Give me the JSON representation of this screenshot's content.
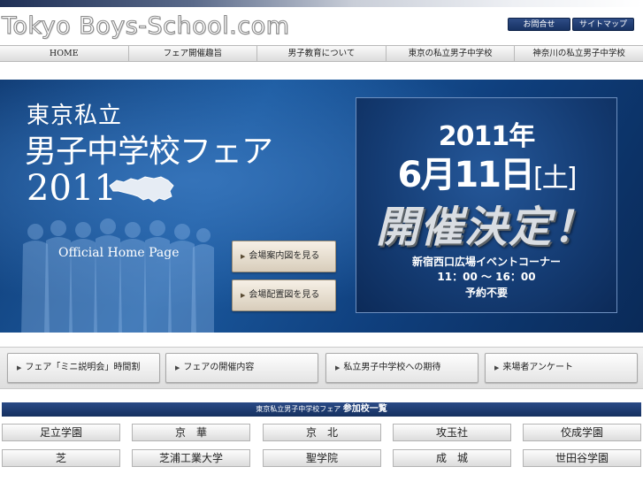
{
  "header": {
    "logo": "Tokyo Boys-School.com",
    "inquiry_label": "お問合せ",
    "sitemap_label": "サイトマップ"
  },
  "nav": {
    "items": [
      "HOME",
      "フェア開催趣旨",
      "男子教育について",
      "東京の私立男子中学校",
      "神奈川の私立男子中学校"
    ]
  },
  "hero": {
    "subtitle": "東京私立",
    "title": "男子中学校フェア",
    "year": "2011",
    "official": "Official Home Page",
    "btn_map": "会場案内図を見る",
    "btn_layout": "会場配置図を見る",
    "date_year": "2011年",
    "date_day": "6月11日",
    "date_weekday": "[土]",
    "date_main": "開催決定！",
    "venue": "新宿西口広場イベントコーナー",
    "hours": "11：00 〜 16：00",
    "no_reservation": "予約不要"
  },
  "subnav": {
    "items": [
      "フェア「ミニ説明会」時間割",
      "フェアの開催内容",
      "私立男子中学校への期待",
      "来場者アンケート"
    ]
  },
  "schools": {
    "heading_small": "東京私立男子中学校フェア",
    "heading_big": "参加校一覧",
    "items": [
      "足立学園",
      "京　華",
      "京　北",
      "攻玉社",
      "佼成学園",
      "芝",
      "芝浦工業大学",
      "聖学院",
      "成　城",
      "世田谷学園"
    ]
  }
}
